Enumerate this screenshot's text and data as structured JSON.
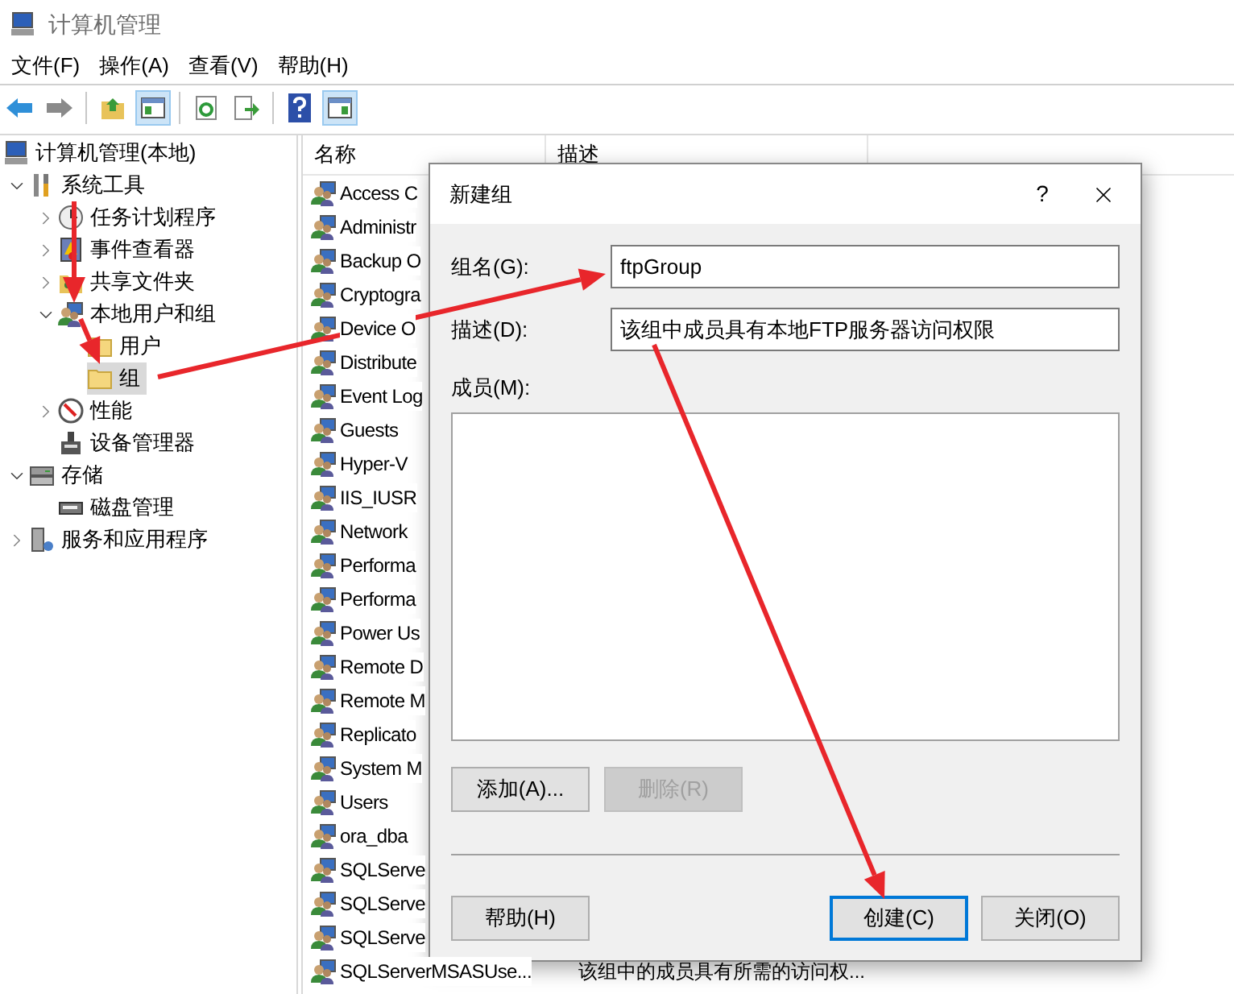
{
  "window": {
    "title": "计算机管理"
  },
  "menu": [
    "文件(F)",
    "操作(A)",
    "查看(V)",
    "帮助(H)"
  ],
  "toolbar": [
    [
      {
        "kind": "back",
        "on": false
      },
      {
        "kind": "forward",
        "on": false
      }
    ],
    [
      {
        "kind": "up",
        "on": false
      },
      {
        "kind": "tree",
        "on": true
      }
    ],
    [
      {
        "kind": "refresh",
        "on": false
      },
      {
        "kind": "export",
        "on": false
      }
    ],
    [
      {
        "kind": "help",
        "on": false
      },
      {
        "kind": "pane",
        "on": true
      }
    ]
  ],
  "tree": [
    {
      "label": "计算机管理(本地)",
      "kind": "computer",
      "selected": false,
      "children": [
        {
          "label": "系统工具",
          "kind": "tools",
          "expanded": true,
          "selected": false,
          "children": [
            {
              "label": "任务计划程序",
              "kind": "clock",
              "expanded": false,
              "selected": false
            },
            {
              "label": "事件查看器",
              "kind": "event",
              "expanded": false,
              "selected": false
            },
            {
              "label": "共享文件夹",
              "kind": "share",
              "expanded": false,
              "selected": false
            },
            {
              "label": "本地用户和组",
              "kind": "users",
              "expanded": true,
              "selected": false,
              "children": [
                {
                  "label": "用户",
                  "kind": "folder",
                  "selected": false
                },
                {
                  "label": "组",
                  "kind": "folder",
                  "selected": true
                }
              ]
            },
            {
              "label": "性能",
              "kind": "perf",
              "expanded": false,
              "selected": false
            },
            {
              "label": "设备管理器",
              "kind": "device",
              "selected": false
            }
          ]
        },
        {
          "label": "存储",
          "kind": "storage",
          "expanded": true,
          "selected": false,
          "children": [
            {
              "label": "磁盘管理",
              "kind": "disk",
              "selected": false
            }
          ]
        },
        {
          "label": "服务和应用程序",
          "kind": "services",
          "expanded": false,
          "selected": false
        }
      ]
    }
  ],
  "list": {
    "columns": [
      "名称",
      "描述"
    ],
    "rows": [
      {
        "name": "Access C"
      },
      {
        "name": "Administr"
      },
      {
        "name": "Backup O"
      },
      {
        "name": "Cryptogra"
      },
      {
        "name": "Device O"
      },
      {
        "name": "Distribute"
      },
      {
        "name": "Event Log"
      },
      {
        "name": "Guests"
      },
      {
        "name": "Hyper-V"
      },
      {
        "name": "IIS_IUSR"
      },
      {
        "name": "Network"
      },
      {
        "name": "Performa"
      },
      {
        "name": "Performa"
      },
      {
        "name": "Power Us"
      },
      {
        "name": "Remote D"
      },
      {
        "name": "Remote M"
      },
      {
        "name": "Replicato"
      },
      {
        "name": "System M"
      },
      {
        "name": "Users"
      },
      {
        "name": "ora_dba"
      },
      {
        "name": "SQLServe"
      },
      {
        "name": "SQLServe"
      },
      {
        "name": "SQLServe"
      },
      {
        "name": "SQLServerMSASUse...",
        "description": "该组中的成员具有所需的访问权..."
      }
    ]
  },
  "dialog": {
    "title": "新建组",
    "help": "?",
    "fields": [
      {
        "label": "组名(G):",
        "value": "ftpGroup"
      },
      {
        "label": "描述(D):",
        "value": "该组中成员具有本地FTP服务器访问权限"
      }
    ],
    "members_label": "成员(M):",
    "member_buttons": [
      {
        "label": "添加(A)...",
        "disabled": false
      },
      {
        "label": "删除(R)",
        "disabled": true
      }
    ],
    "buttons": [
      {
        "label": "帮助(H)",
        "default": false
      },
      {
        "label": "创建(C)",
        "default": true
      },
      {
        "label": "关闭(O)",
        "default": false
      }
    ]
  }
}
